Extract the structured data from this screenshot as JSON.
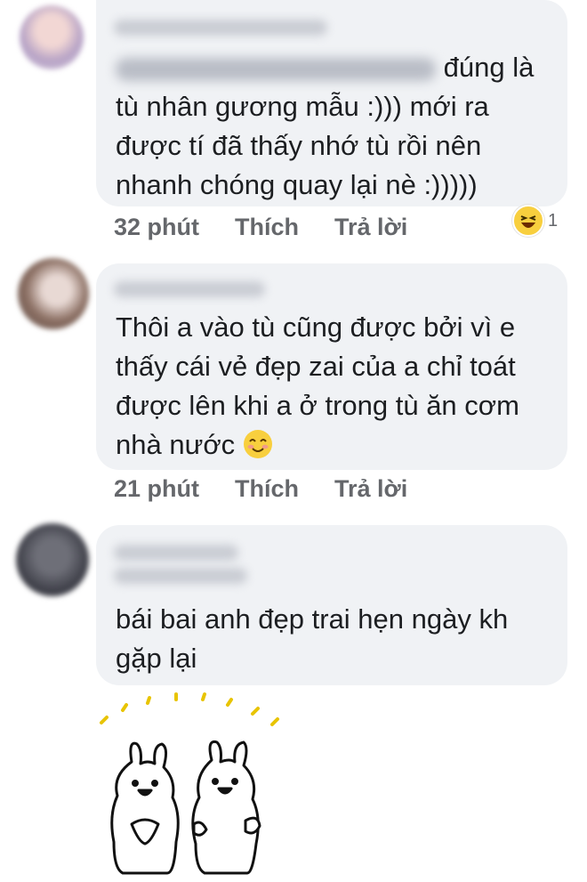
{
  "comments": [
    {
      "text_line1_suffix": "đúng",
      "text_rest": "là tù nhân gương mẫu :))) mới ra được tí đã thấy nhớ tù rồi nên nhanh chóng quay lại nè :)))))",
      "time": "32 phút",
      "like_label": "Thích",
      "reply_label": "Trả lời",
      "reaction_count": "1",
      "reaction_icon": "laughing-emoji"
    },
    {
      "text": "Thôi a vào tù cũng được bởi vì e thấy cái vẻ đẹp zai của a chỉ toát được lên khi a ở trong tù ăn cơm nhà nước",
      "inline_emoji": "smiling-emoji",
      "time": "21 phút",
      "like_label": "Thích",
      "reply_label": "Trả lời"
    },
    {
      "text": "bái bai anh đẹp trai hẹn ngày kh gặp lại",
      "sticker": "two-bunnies-waving-sticker"
    }
  ],
  "colors": {
    "bubble": "#f0f2f5",
    "text": "#1c1e21",
    "meta": "#65676b",
    "emoji": "#f8cf3e"
  }
}
